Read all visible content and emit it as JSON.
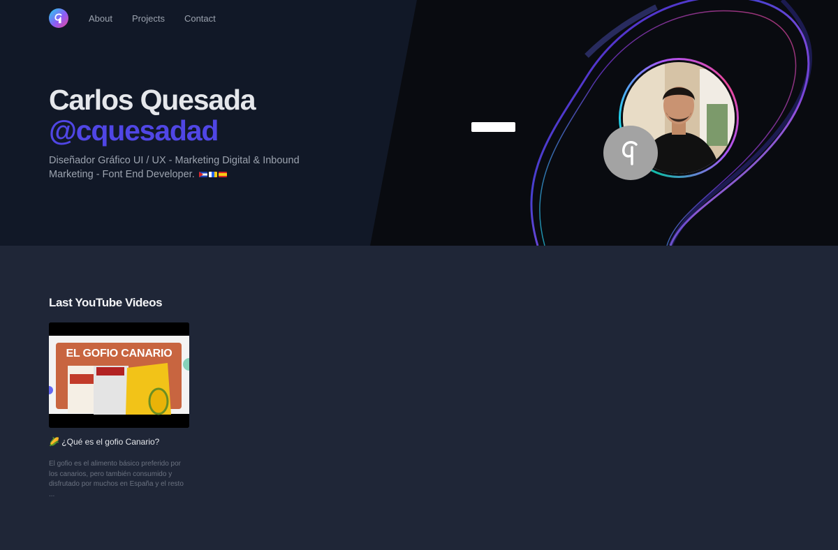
{
  "nav": {
    "logo_icon": "brand-logo-icon",
    "links": [
      {
        "label": "About"
      },
      {
        "label": "Projects"
      },
      {
        "label": "Contact"
      }
    ]
  },
  "hero": {
    "name": "Carlos Quesada",
    "handle": "@cquesadad",
    "description": "Diseñador Gráfico UI / UX - Marketing Digital & Inbound Marketing - Font End Developer.",
    "flags": [
      "cuba-flag-icon",
      "canary-islands-flag-icon",
      "spain-flag-icon"
    ]
  },
  "videos": {
    "section_title": "Last YouTube Videos",
    "items": [
      {
        "thumbnail_text": "EL GOFIO CANARIO",
        "title_icon": "corn-icon",
        "title": "🌽 ¿Qué es el gofio Canario?",
        "description": "El gofio es el alimento básico preferido por los canarios, pero también consumido y disfrutado por muchos en España y el resto ..."
      }
    ]
  },
  "colors": {
    "accent": "#5046e5",
    "hero_bg": "#111827",
    "section_bg": "#1f2637"
  }
}
